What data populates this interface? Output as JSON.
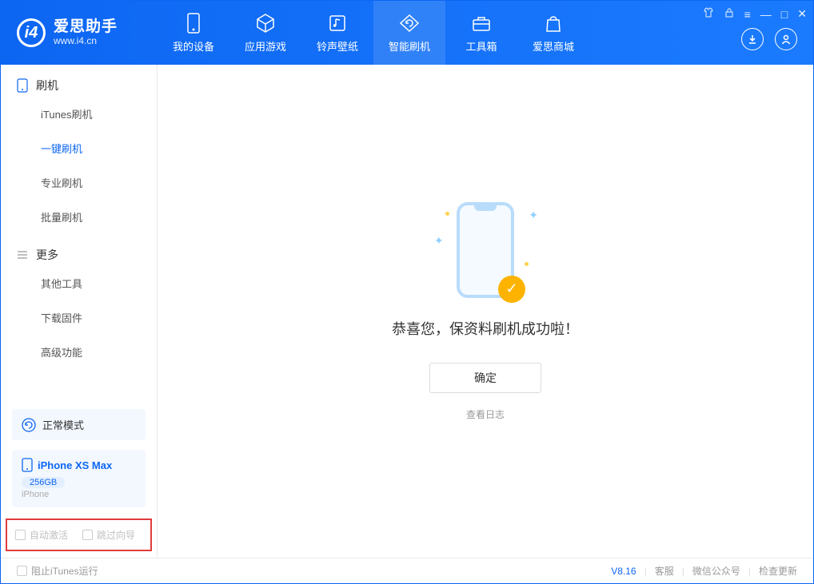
{
  "app": {
    "title": "爱思助手",
    "url": "www.i4.cn"
  },
  "nav": {
    "items": [
      {
        "label": "我的设备",
        "icon": "device"
      },
      {
        "label": "应用游戏",
        "icon": "cube"
      },
      {
        "label": "铃声壁纸",
        "icon": "music"
      },
      {
        "label": "智能刷机",
        "icon": "refresh"
      },
      {
        "label": "工具箱",
        "icon": "toolbox"
      },
      {
        "label": "爱思商城",
        "icon": "bag"
      }
    ],
    "active_index": 3
  },
  "header_icons": {
    "download": "download-icon",
    "user": "user-icon"
  },
  "sidebar": {
    "groups": [
      {
        "title": "刷机",
        "icon": "phone",
        "items": [
          "iTunes刷机",
          "一键刷机",
          "专业刷机",
          "批量刷机"
        ],
        "selected_index": 1
      },
      {
        "title": "更多",
        "icon": "menu",
        "items": [
          "其他工具",
          "下载固件",
          "高级功能"
        ],
        "selected_index": -1
      }
    ],
    "mode": {
      "label": "正常模式"
    },
    "device": {
      "name": "iPhone XS Max",
      "capacity": "256GB",
      "type": "iPhone"
    },
    "options": [
      {
        "label": "自动激活",
        "checked": false
      },
      {
        "label": "跳过向导",
        "checked": false
      }
    ]
  },
  "main": {
    "success_text": "恭喜您，保资料刷机成功啦！",
    "ok_button": "确定",
    "view_log": "查看日志"
  },
  "statusbar": {
    "block_itunes": "阻止iTunes运行",
    "version": "V8.16",
    "links": [
      "客服",
      "微信公众号",
      "检查更新"
    ]
  }
}
